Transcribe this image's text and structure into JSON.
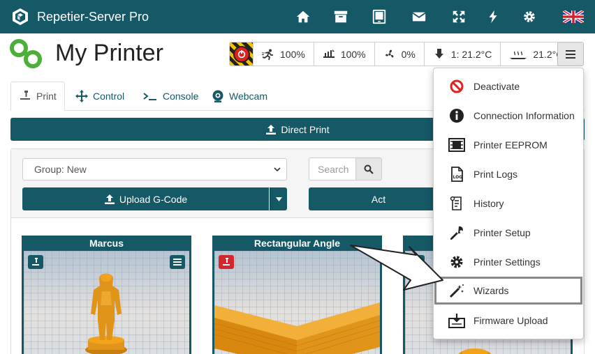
{
  "app": {
    "title": "Repetier-Server Pro"
  },
  "printer": {
    "name": "My Printer"
  },
  "status": {
    "speed": "100%",
    "flow": "100%",
    "fan": "0%",
    "extruder_temp": "1: 21.2°C",
    "bed_temp": "21.2°C"
  },
  "tabs": [
    {
      "label": "Print"
    },
    {
      "label": "Control"
    },
    {
      "label": "Console"
    },
    {
      "label": "Webcam"
    }
  ],
  "print": {
    "direct_print_label": "Direct Print",
    "group_select_value": "Group: New",
    "search_placeholder": "Search",
    "upload_label": "Upload G-Code",
    "actions_label": "Act"
  },
  "models": [
    {
      "name": "Marcus"
    },
    {
      "name": "Rectangular Angle"
    }
  ],
  "menu": {
    "items": [
      {
        "label": "Deactivate"
      },
      {
        "label": "Connection Information"
      },
      {
        "label": "Printer EEPROM"
      },
      {
        "label": "Print Logs"
      },
      {
        "label": "History"
      },
      {
        "label": "Printer Setup"
      },
      {
        "label": "Printer Settings"
      },
      {
        "label": "Wizards"
      },
      {
        "label": "Firmware Upload"
      }
    ]
  },
  "colors": {
    "brand": "#155866",
    "deactivate_red": "#e0211d",
    "logo_green": "#4caf3a",
    "model_orange": "#f2a31a"
  }
}
